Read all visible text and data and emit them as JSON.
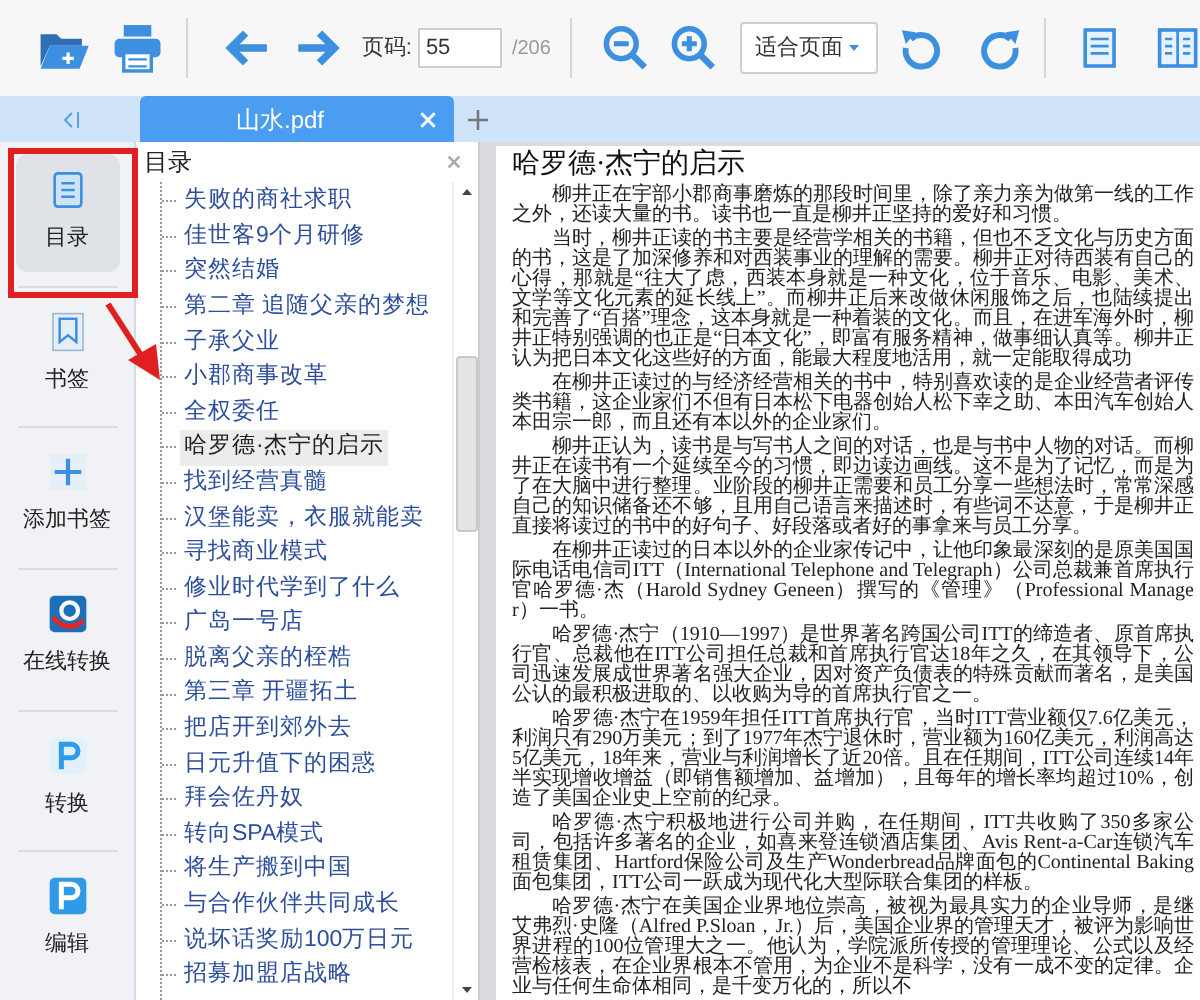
{
  "toolbar": {
    "page_label": "页码:",
    "page_input": "55",
    "page_total": "/206",
    "zoom_select": "适合页面"
  },
  "tabs": [
    {
      "label": "山水.pdf",
      "selected": true
    }
  ],
  "sidebar": {
    "items": [
      {
        "label": "目录",
        "kind": "toc",
        "selected": true
      },
      {
        "label": "书签",
        "kind": "bookmark",
        "selected": false
      },
      {
        "label": "添加书签",
        "kind": "add",
        "selected": false
      },
      {
        "label": "在线转换",
        "kind": "online",
        "selected": false
      },
      {
        "label": "转换",
        "kind": "convert",
        "selected": false
      },
      {
        "label": "编辑",
        "kind": "edit",
        "selected": false
      }
    ]
  },
  "toc": {
    "title": "目录",
    "items": [
      {
        "label": "失败的商社求职",
        "selected": false
      },
      {
        "label": "佳世客9个月研修",
        "selected": false
      },
      {
        "label": "突然结婚",
        "selected": false
      },
      {
        "label": "第二章 追随父亲的梦想",
        "selected": false
      },
      {
        "label": "子承父业",
        "selected": false
      },
      {
        "label": "小郡商事改革",
        "selected": false
      },
      {
        "label": "全权委任",
        "selected": false
      },
      {
        "label": "哈罗德·杰宁的启示",
        "selected": true
      },
      {
        "label": "找到经营真髓",
        "selected": false
      },
      {
        "label": "汉堡能卖，衣服就能卖",
        "selected": false
      },
      {
        "label": "寻找商业模式",
        "selected": false
      },
      {
        "label": "修业时代学到了什么",
        "selected": false
      },
      {
        "label": "广岛一号店",
        "selected": false
      },
      {
        "label": "脱离父亲的桎梏",
        "selected": false
      },
      {
        "label": "第三章 开疆拓土",
        "selected": false
      },
      {
        "label": "把店开到郊外去",
        "selected": false
      },
      {
        "label": "日元升值下的困惑",
        "selected": false
      },
      {
        "label": "拜会佐丹奴",
        "selected": false
      },
      {
        "label": "转向SPA模式",
        "selected": false
      },
      {
        "label": "将生产搬到中国",
        "selected": false
      },
      {
        "label": "与合作伙伴共同成长",
        "selected": false
      },
      {
        "label": "说坏话奖励100万日元",
        "selected": false
      },
      {
        "label": "招募加盟店战略",
        "selected": false
      }
    ]
  },
  "document": {
    "title": "哈罗德·杰宁的启示",
    "paragraphs": [
      [
        "柳井正在宇部小郡商事磨炼的那段时间里，除了亲力亲为做第一线的工作之外，还读大量的书。读书也一直是柳井正坚持的爱好和习惯。"
      ],
      [
        "当时，柳井正读的书主要是经营学相关的书籍，但也不乏文化与历史方面的书，这是了加深修养和对西装事业的理解的需要。柳井正对待西装有自己的心得，那就是“往大了虑，西装本身就是一种文化，位于音乐、电影、美术、文学等文化元素的延长线上”。而柳井正后来改做休闲服饰之后，也陆续提出和完善了“百搭”理念，这本身就是一种着装的文化。而且，在进军海外时，柳井正特别强调的也正是“日本文化”，即富有服务精神，做事细认真等。柳井正认为把日本文化这些好的方面，能最大程度地活用，就一定能取得成功"
      ],
      [
        "在柳井正读过的与经济经营相关的书中，特别喜欢读的是企业经营者评传类书籍，这企业家们不但有日本松下电器创始人松下幸之助、本田汽车创始人本田宗一郎，而且还有本以外的企业家们。"
      ],
      [
        "柳井正认为，读书是与写书人之间的对话，也是与书中人物的对话。而柳井正在读书有一个延续至今的习惯，即边读边画线。这不是为了记忆，而是为了在大脑中进行整理。业阶段的柳井正需要和员工分享一些想法时，常常深感自己的知识储备还不够，且用自己语言来描述时，有些词不达意，于是柳井正直接将读过的书中的好句子、好段落或者好的事拿来与员工分享。"
      ],
      [
        "在柳井正读过的日本以外的企业家传记中，让他印象最深刻的是原美国国际电话电信司ITT（International Telephone and Telegraph）公司总裁兼首席执行官哈罗德·杰（Harold Sydney Geneen）撰写的《管理》（Professional Manager）一书。"
      ],
      [
        "哈罗德·杰宁（1910—1997）是世界著名跨国公司ITT的缔造者、原首席执行官、总裁他在ITT公司担任总裁和首席执行官达18年之久，在其领导下，公司迅速发展成世界著名强大企业，因对资产负债表的特殊贡献而著名，是美国公认的最积极进取的、以收购为导的首席执行官之一。"
      ],
      [
        "哈罗德·杰宁在1959年担任ITT首席执行官，当时ITT营业额仅7.6亿美元，利润只有290万美元；到了1977年杰宁退休时，营业额为160亿美元，利润高达5亿美元，18年来，营业与利润增长了近20倍。且在任期间，ITT公司连续14年半实现增收增益（即销售额增加、益增加），且每年的增长率均超过10%，创造了美国企业史上空前的纪录。"
      ],
      [
        "哈罗德·杰宁积极地进行公司并购，在任期间，ITT共收购了350多家公司，包括许多著名的企业，如喜来登连锁酒店集团、Avis Rent-a-Car连锁汽车租赁集团、Hartford保险公司及生产Wonderbread品牌面包的Continental Baking面包集团，ITT公司一跃成为现代化大型际联合集团的样板。"
      ],
      [
        "哈罗德·杰宁在美国企业界地位崇高，被视为最具实力的企业导师，是继艾弗烈·史隆（Alfred P.Sloan，Jr.）后，美国企业界的管理天才，被评为影响世界进程的100位管理大之一。他认为，学院派所传授的管理理论、公式以及经营检核表，在企业界根本不管用，为企业不是科学，没有一成不变的定律。企业与任何生命体相同，是千变万化的，所以不"
      ]
    ]
  }
}
